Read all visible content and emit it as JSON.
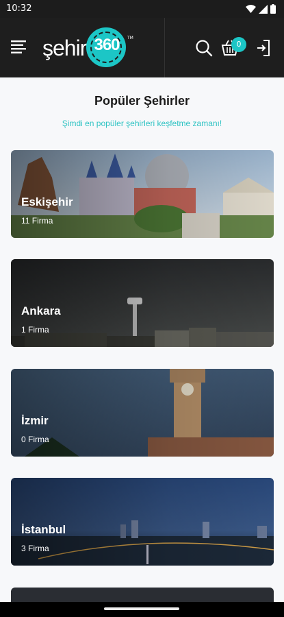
{
  "status_bar": {
    "time": "10:32"
  },
  "header": {
    "logo_text": "şehir",
    "logo_number": "360",
    "logo_tm": "TM",
    "cart_count": "0"
  },
  "page": {
    "title": "Popüler Şehirler",
    "subtitle": "Şimdi en popüler şehirleri keşfetme zamanı!"
  },
  "cities": [
    {
      "name": "Eskişehir",
      "count": "11 Firma"
    },
    {
      "name": "Ankara",
      "count": "1 Firma"
    },
    {
      "name": "İzmir",
      "count": "0 Firma"
    },
    {
      "name": "İstanbul",
      "count": "3 Firma"
    }
  ],
  "colors": {
    "accent": "#1cc6c6",
    "header_bg": "#1e1e1e",
    "page_bg": "#f7f8fa"
  }
}
